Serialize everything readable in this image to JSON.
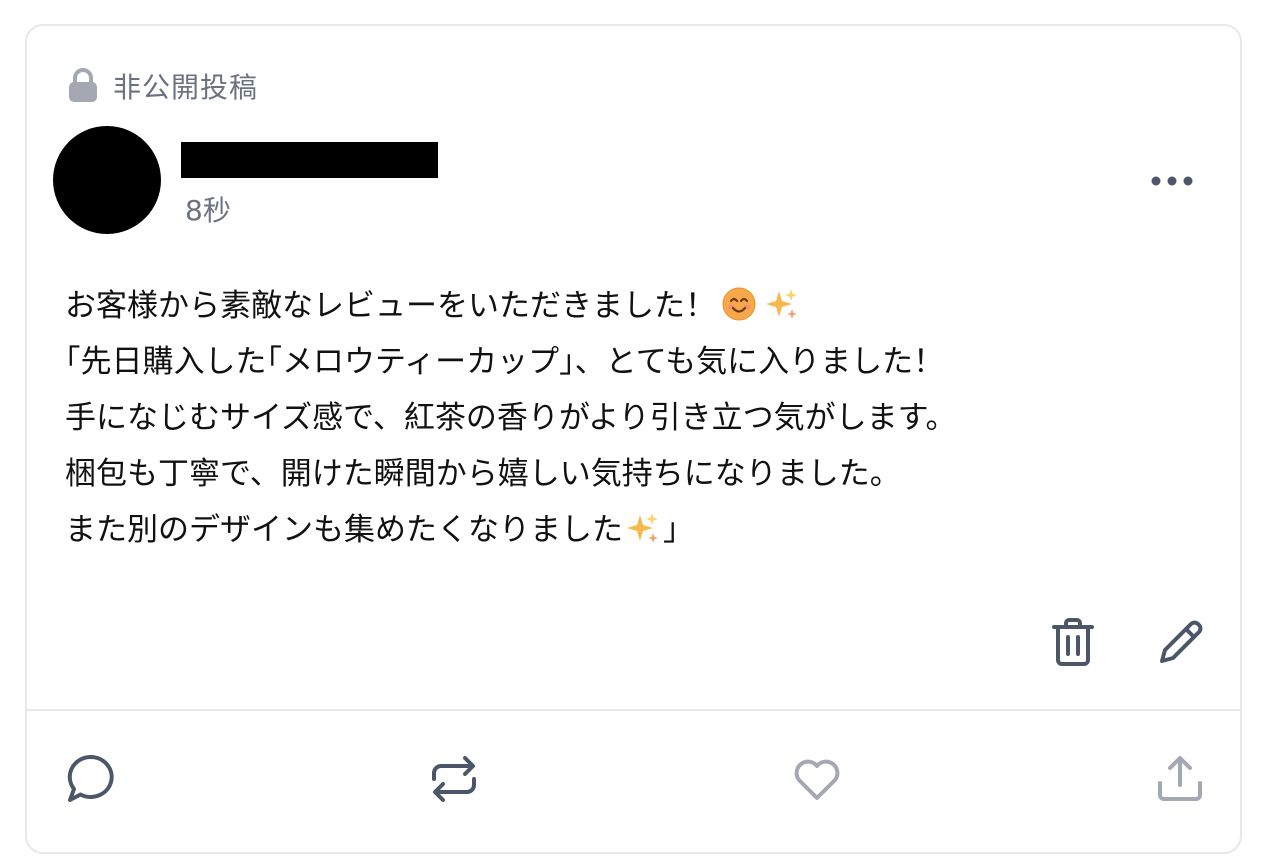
{
  "header": {
    "visibility_label": "非公開投稿",
    "visibility_icon": "lock-icon"
  },
  "author": {
    "name": "",
    "avatar_color": "#000000",
    "timestamp": "8秒"
  },
  "post": {
    "lines": [
      {
        "text": "お客様から素敵なレビューをいただきました！",
        "trailing_emoji": [
          "smiling-face-emoji",
          "sparkles-emoji"
        ]
      },
      {
        "text": "｢先日購入した｢メロウティーカップ｣、とても気に入りました！"
      },
      {
        "text": "手になじむサイズ感で、紅茶の香りがより引き立つ気がします。"
      },
      {
        "text": "梱包も丁寧で、開けた瞬間から嬉しい気持ちになりました。"
      },
      {
        "text_before": "また別のデザインも集めたくなりました",
        "inline_emoji": "sparkles-emoji",
        "text_after": "｣"
      }
    ]
  },
  "owner_actions": {
    "delete_icon": "trash-icon",
    "edit_icon": "pencil-icon"
  },
  "action_bar": {
    "reply_icon": "comment-icon",
    "repost_icon": "repost-icon",
    "like_icon": "heart-icon",
    "share_icon": "share-icon"
  },
  "colors": {
    "border": "#e6e8eb",
    "muted_text": "#6b7280",
    "icon_dark": "#4b5768",
    "icon_light": "#a3a8b3"
  }
}
